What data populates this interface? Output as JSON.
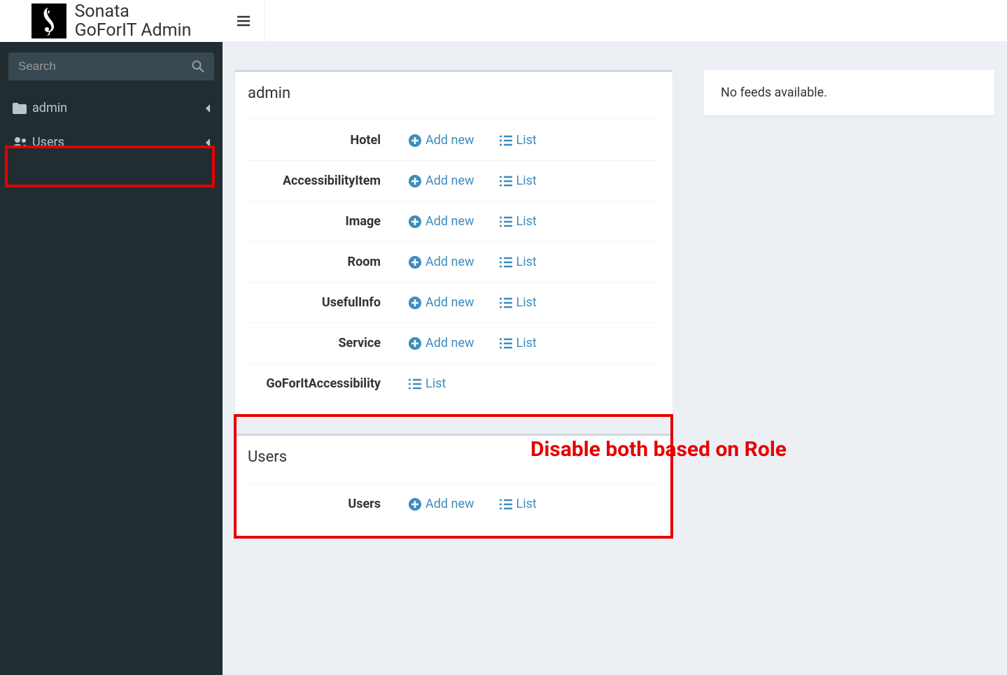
{
  "header": {
    "app_title_line1": "Sonata",
    "app_title_line2": "GoForIT Admin"
  },
  "sidebar": {
    "search_placeholder": "Search",
    "items": [
      {
        "icon": "folder",
        "label": "admin"
      },
      {
        "icon": "users",
        "label": "Users"
      }
    ]
  },
  "panels": [
    {
      "title": "admin",
      "rows": [
        {
          "name": "Hotel",
          "add": "Add new",
          "list": "List"
        },
        {
          "name": "AccessibilityItem",
          "add": "Add new",
          "list": "List"
        },
        {
          "name": "Image",
          "add": "Add new",
          "list": "List"
        },
        {
          "name": "Room",
          "add": "Add new",
          "list": "List"
        },
        {
          "name": "UsefulInfo",
          "add": "Add new",
          "list": "List"
        },
        {
          "name": "Service",
          "add": "Add new",
          "list": "List"
        },
        {
          "name": "GoForItAccessibility",
          "add": null,
          "list": "List"
        }
      ]
    },
    {
      "title": "Users",
      "rows": [
        {
          "name": "Users",
          "add": "Add new",
          "list": "List"
        }
      ]
    }
  ],
  "feed": {
    "message": "No feeds available."
  },
  "annotation": {
    "text": "Disable both based on Role"
  }
}
